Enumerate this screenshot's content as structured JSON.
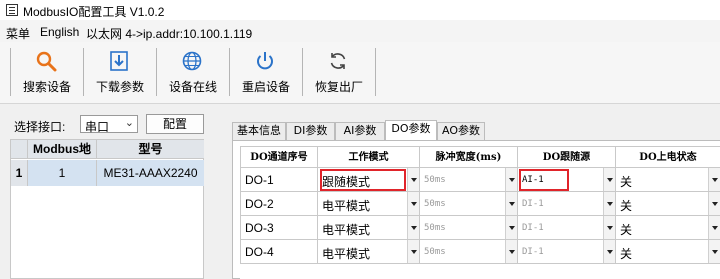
{
  "window": {
    "title": "ModbusIO配置工具 V1.0.2"
  },
  "menu": {
    "items": [
      "菜单",
      "English",
      "以太网 4->ip.addr:10.100.1.119"
    ]
  },
  "toolbar": {
    "buttons": [
      {
        "label": "搜索设备",
        "icon": "search-icon",
        "color": "#e8731a"
      },
      {
        "label": "下载参数",
        "icon": "download-icon",
        "color": "#2b73c9"
      },
      {
        "label": "设备在线",
        "icon": "globe-icon",
        "color": "#2b73c9"
      },
      {
        "label": "重启设备",
        "icon": "power-icon",
        "color": "#2b73c9"
      },
      {
        "label": "恢复出厂",
        "icon": "refresh-icon",
        "color": "#444444"
      }
    ]
  },
  "left": {
    "port_label": "选择接口:",
    "port_value": "串口",
    "config_label": "配置",
    "table": {
      "headers": [
        "Modbus地址",
        "型号"
      ],
      "rows": [
        {
          "index": "1",
          "address": "1",
          "model": "ME31-AAAX2240"
        }
      ]
    }
  },
  "tabs": [
    "基本信息",
    "DI参数",
    "AI参数",
    "DO参数",
    "AO参数"
  ],
  "active_tab": "DO参数",
  "grid": {
    "headers": [
      "DO通道序号",
      "工作模式",
      "脉冲宽度(ms)",
      "DO跟随源",
      "DO上电状态"
    ],
    "rows": [
      {
        "channel": "DO-1",
        "mode": "跟随模式",
        "pulse": "50ms",
        "source": "AI-1",
        "state": "关"
      },
      {
        "channel": "DO-2",
        "mode": "电平模式",
        "pulse": "50ms",
        "source": "DI-1",
        "state": "关"
      },
      {
        "channel": "DO-3",
        "mode": "电平模式",
        "pulse": "50ms",
        "source": "DI-1",
        "state": "关"
      },
      {
        "channel": "DO-4",
        "mode": "电平模式",
        "pulse": "50ms",
        "source": "DI-1",
        "state": "关"
      }
    ]
  },
  "colors": {
    "highlight": "#e0242a",
    "selected_row": "#d4e2f1"
  }
}
